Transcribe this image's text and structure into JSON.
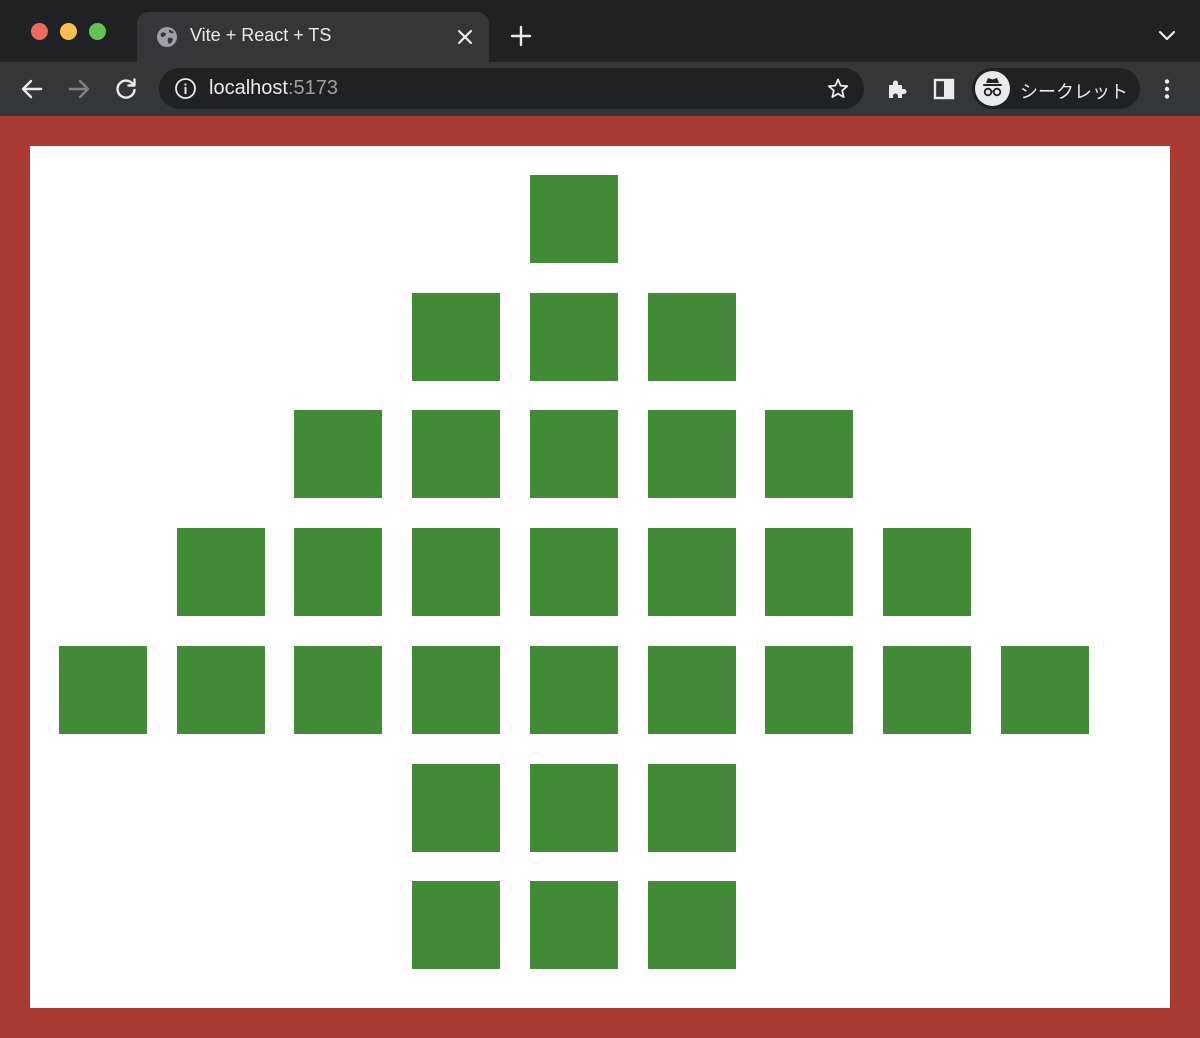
{
  "window": {
    "traffic_lights": [
      "close",
      "minimize",
      "zoom"
    ]
  },
  "tab": {
    "title": "Vite + React + TS",
    "favicon": "globe-icon"
  },
  "toolbar": {
    "address": {
      "host": "localhost",
      "port": ":5173"
    },
    "profile_label": "シークレット"
  },
  "page": {
    "background_color": "#a93a31",
    "canvas_color": "#ffffff",
    "square_color": "#428a37",
    "grid": {
      "columns": 9,
      "rows": [
        {
          "row": 1,
          "filled_columns": [
            5
          ]
        },
        {
          "row": 2,
          "filled_columns": [
            4,
            5,
            6
          ]
        },
        {
          "row": 3,
          "filled_columns": [
            3,
            4,
            5,
            6,
            7
          ]
        },
        {
          "row": 4,
          "filled_columns": [
            2,
            3,
            4,
            5,
            6,
            7,
            8
          ]
        },
        {
          "row": 5,
          "filled_columns": [
            1,
            2,
            3,
            4,
            5,
            6,
            7,
            8,
            9
          ]
        },
        {
          "row": 6,
          "filled_columns": [
            4,
            5,
            6
          ]
        },
        {
          "row": 7,
          "filled_columns": [
            4,
            5,
            6
          ]
        }
      ]
    }
  }
}
